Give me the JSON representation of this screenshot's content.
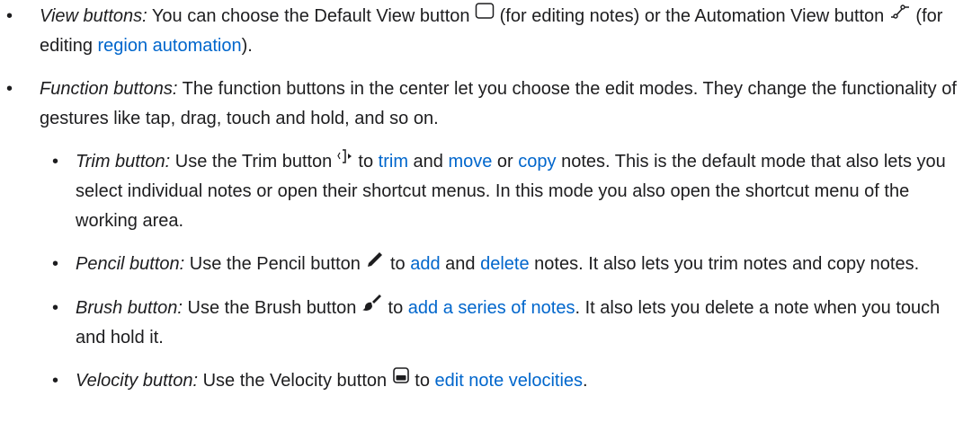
{
  "items": [
    {
      "term": "View buttons:",
      "t1": " You can choose the Default View button ",
      "t2": " (for editing notes) or the Automation View button ",
      "t3": " (for editing ",
      "link1": "region automation",
      "t4": ").",
      "icons": [
        "default-view-icon",
        "automation-view-icon"
      ]
    },
    {
      "term": "Function buttons:",
      "t1": " The function buttons in the center let you choose the edit modes. They change the functionality of gestures like tap, drag, touch and hold, and so on.",
      "sub": [
        {
          "term": "Trim button:",
          "t1": " Use the Trim button ",
          "icon": "trim-icon",
          "t2": " to ",
          "link1": "trim",
          "t3": " and ",
          "link2": "move",
          "t4": " or ",
          "link3": "copy",
          "t5": " notes. This is the default mode that also lets you select individual notes or open their shortcut menus. In this mode you also open the shortcut menu of the working area."
        },
        {
          "term": "Pencil button:",
          "t1": " Use the Pencil button ",
          "icon": "pencil-icon",
          "t2": " to ",
          "link1": "add",
          "t3": " and ",
          "link2": "delete",
          "t4": " notes. It also lets you trim notes and copy notes."
        },
        {
          "term": "Brush button:",
          "t1": " Use the Brush button ",
          "icon": "brush-icon",
          "t2": " to ",
          "link1": "add a series of notes",
          "t3": ". It also lets you delete a note when you touch and hold it."
        },
        {
          "term": "Velocity button:",
          "t1": " Use the Velocity button ",
          "icon": "velocity-icon",
          "t2": " to ",
          "link1": "edit note velocities",
          "t3": "."
        }
      ]
    }
  ],
  "bullet_glyph": "•",
  "link_color": "#0066cc",
  "text_color": "#1d1d1f"
}
